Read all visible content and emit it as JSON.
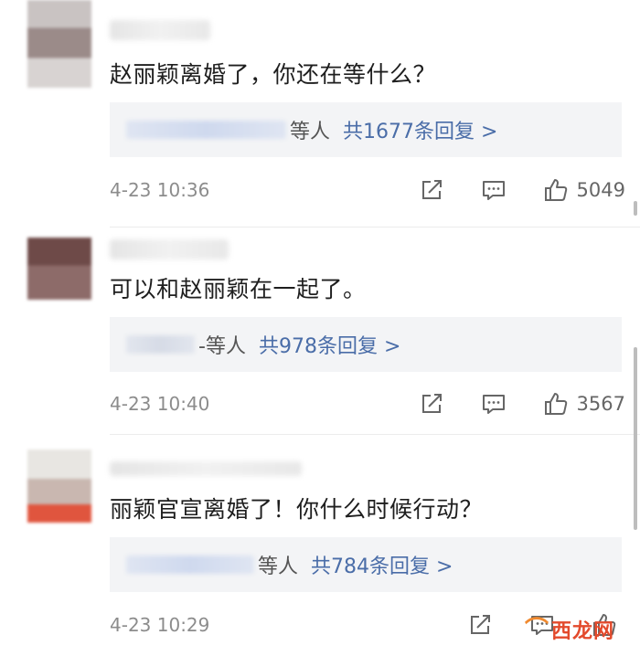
{
  "comments": [
    {
      "text": "赵丽颖离婚了，你还在等什么？",
      "reply_suffix": "等人",
      "reply_count": "共1677条回复 >",
      "time": "4-23 10:36",
      "likes": "5049"
    },
    {
      "text": "可以和赵丽颖在一起了。",
      "reply_suffix": "-等人",
      "reply_count": "共978条回复 >",
      "time": "4-23 10:40",
      "likes": "3567"
    },
    {
      "text": "丽颖官宣离婚了！你什么时候行动？",
      "reply_suffix": "等人",
      "reply_count": "共784条回复 >",
      "time": "4-23 10:29",
      "likes": ""
    }
  ],
  "icons": {
    "share": "share-icon",
    "comment": "comment-icon",
    "like": "thumbs-up-icon"
  },
  "watermark": {
    "mark": "⌒",
    "text": "西龙网"
  },
  "colors": {
    "reply_link": "#4a6da8",
    "reply_bg": "#f3f4f6",
    "meta": "#8c8c8c"
  }
}
